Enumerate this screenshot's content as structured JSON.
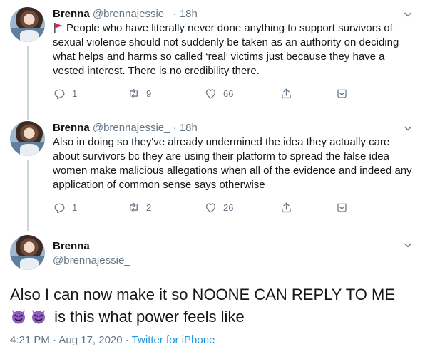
{
  "author": {
    "name": "Brenna",
    "handle": "@brennajessie_"
  },
  "replies": [
    {
      "time": "18h",
      "text": "People who have literally never done anything to support survivors of sexual violence should not suddenly be taken as an authority on deciding what helps and harms so called ‘real’ victims just because they have a vested interest. There is no credibility there.",
      "has_flag": true,
      "reply_count": "1",
      "retweet_count": "9",
      "like_count": "66"
    },
    {
      "time": "18h",
      "text": "Also in doing so they've already undermined the idea they actually care about survivors bc they are using their platform to spread the false idea women make malicious allegations when all of the evidence and indeed any application of common sense says otherwise",
      "has_flag": false,
      "reply_count": "1",
      "retweet_count": "2",
      "like_count": "26"
    }
  ],
  "main_tweet": {
    "line1": "Also I can now make it so NOONE CAN REPLY TO ME",
    "line2": "is this what power feels like",
    "emoji": [
      "smiling-imp",
      "smiling-imp"
    ],
    "timestamp": "4:21 PM · Aug 17, 2020",
    "separator": " · ",
    "source": "Twitter for iPhone"
  },
  "dot": "·",
  "colors": {
    "text": "#14171a",
    "muted": "#657786",
    "link": "#1b95e0",
    "thread_line": "#ccd6dd",
    "flag": "#e0245e",
    "devil": "#8e5cbf"
  }
}
